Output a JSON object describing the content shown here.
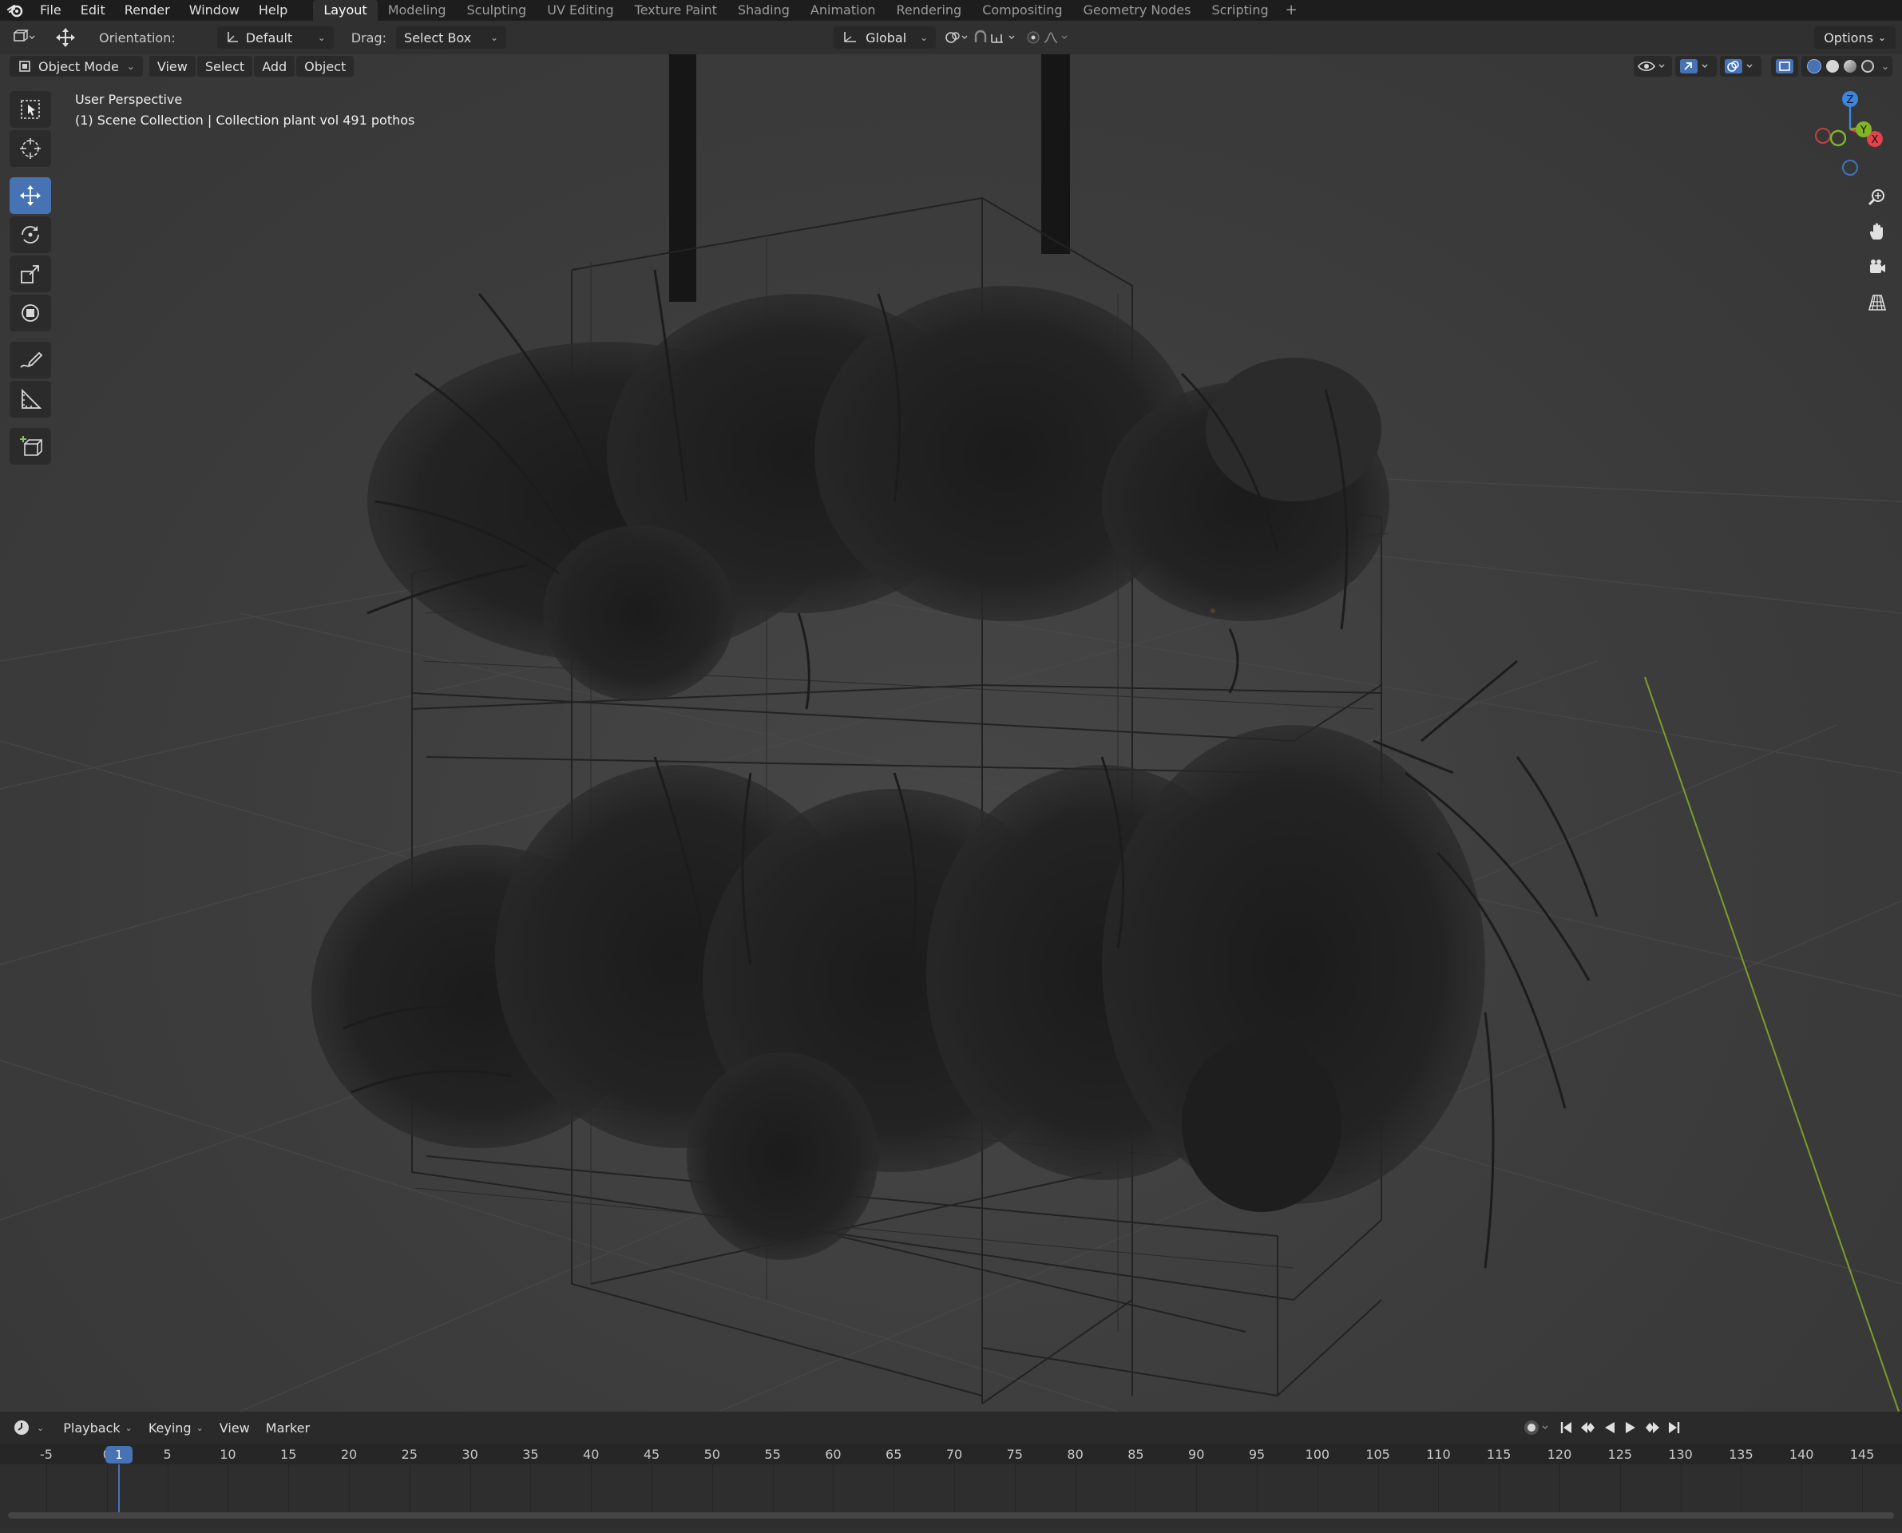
{
  "menubar": {
    "items": [
      "File",
      "Edit",
      "Render",
      "Window",
      "Help"
    ],
    "workspaces": [
      "Layout",
      "Modeling",
      "Sculpting",
      "UV Editing",
      "Texture Paint",
      "Shading",
      "Animation",
      "Rendering",
      "Compositing",
      "Geometry Nodes",
      "Scripting"
    ],
    "active_workspace": "Layout",
    "add_tab": "+"
  },
  "toolbar": {
    "orientation_label": "Orientation:",
    "orientation_value": "Default",
    "drag_label": "Drag:",
    "drag_value": "Select Box",
    "transform_orientation": "Global",
    "options_label": "Options"
  },
  "viewport": {
    "mode": "Object Mode",
    "menus": [
      "View",
      "Select",
      "Add",
      "Object"
    ],
    "perspective_text": "User Perspective",
    "collection_text": "(1) Scene Collection | Collection plant vol 491 pothos",
    "gizmo_axes": {
      "x": "X",
      "y": "Y",
      "z": "Z"
    },
    "colors": {
      "x_axis": "#e3434b",
      "y_axis": "#80b527",
      "z_axis": "#3c86e0",
      "active_tool": "#4772b3"
    }
  },
  "tools": [
    "select-box",
    "cursor",
    "move",
    "rotate",
    "scale",
    "transform",
    "annotate",
    "measure",
    "add-cube"
  ],
  "timeline": {
    "menus": [
      "Playback",
      "Keying",
      "View",
      "Marker"
    ],
    "current_frame": "1",
    "ticks": [
      "-5",
      "0",
      "5",
      "10",
      "15",
      "20",
      "25",
      "30",
      "35",
      "40",
      "45",
      "50",
      "55",
      "60",
      "65",
      "70",
      "75",
      "80",
      "85",
      "90",
      "95",
      "100",
      "105",
      "110",
      "115",
      "120",
      "125",
      "130",
      "135",
      "140",
      "145"
    ]
  }
}
